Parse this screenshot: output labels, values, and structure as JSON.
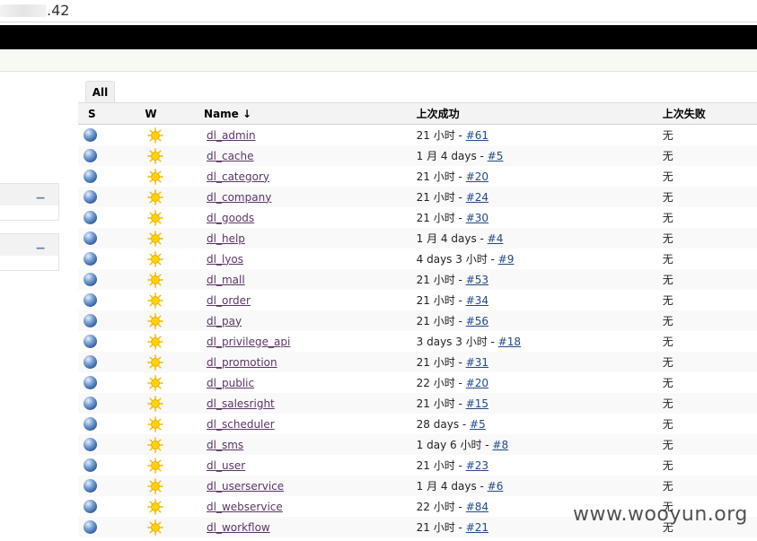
{
  "browser": {
    "url_fragment": ".42"
  },
  "view_tab": {
    "label": "All"
  },
  "columns": {
    "status": "S",
    "weather": "W",
    "name": "Name ↓",
    "last_success": "上次成功",
    "last_failure": "上次失败"
  },
  "jobs": [
    {
      "name": "dl_admin",
      "success_prefix": "21 小时 - ",
      "build": "#61",
      "failure": "无"
    },
    {
      "name": "dl_cache",
      "success_prefix": "1 月 4 days - ",
      "build": "#5",
      "failure": "无"
    },
    {
      "name": "dl_category",
      "success_prefix": "21 小时 - ",
      "build": "#20",
      "failure": "无"
    },
    {
      "name": "dl_company",
      "success_prefix": "21 小时 - ",
      "build": "#24",
      "failure": "无"
    },
    {
      "name": "dl_goods",
      "success_prefix": "21 小时 - ",
      "build": "#30",
      "failure": "无"
    },
    {
      "name": "dl_help",
      "success_prefix": "1 月 4 days - ",
      "build": "#4",
      "failure": "无"
    },
    {
      "name": "dl_lyos",
      "success_prefix": "4 days 3 小时 - ",
      "build": "#9",
      "failure": "无"
    },
    {
      "name": "dl_mall",
      "success_prefix": "21 小时 - ",
      "build": "#53",
      "failure": "无"
    },
    {
      "name": "dl_order",
      "success_prefix": "21 小时 - ",
      "build": "#34",
      "failure": "无"
    },
    {
      "name": "dl_pay",
      "success_prefix": "21 小时 - ",
      "build": "#56",
      "failure": "无"
    },
    {
      "name": "dl_privilege_api",
      "success_prefix": "3 days 3 小时 - ",
      "build": "#18",
      "failure": "无"
    },
    {
      "name": "dl_promotion",
      "success_prefix": "21 小时 - ",
      "build": "#31",
      "failure": "无"
    },
    {
      "name": "dl_public",
      "success_prefix": "22 小时 - ",
      "build": "#20",
      "failure": "无"
    },
    {
      "name": "dl_salesright",
      "success_prefix": "21 小时 - ",
      "build": "#15",
      "failure": "无"
    },
    {
      "name": "dl_scheduler",
      "success_prefix": "28 days - ",
      "build": "#5",
      "failure": "无"
    },
    {
      "name": "dl_sms",
      "success_prefix": "1 day 6 小时 - ",
      "build": "#8",
      "failure": "无"
    },
    {
      "name": "dl_user",
      "success_prefix": "21 小时 - ",
      "build": "#23",
      "failure": "无"
    },
    {
      "name": "dl_userservice",
      "success_prefix": "1 月 4 days - ",
      "build": "#6",
      "failure": "无"
    },
    {
      "name": "dl_webservice",
      "success_prefix": "22 小时 - ",
      "build": "#84",
      "failure": "无"
    },
    {
      "name": "dl_workflow",
      "success_prefix": "21 小时 - ",
      "build": "#21",
      "failure": "无"
    }
  ],
  "sidebar": {
    "collapse_symbol": "−"
  },
  "watermark": "www.wooyun.org",
  "icons": {
    "status": "blue-ball-icon",
    "weather": "sunny-icon"
  },
  "colors": {
    "job_link": "#5c3566",
    "build_link": "#204a87",
    "topbar": "#000000"
  }
}
